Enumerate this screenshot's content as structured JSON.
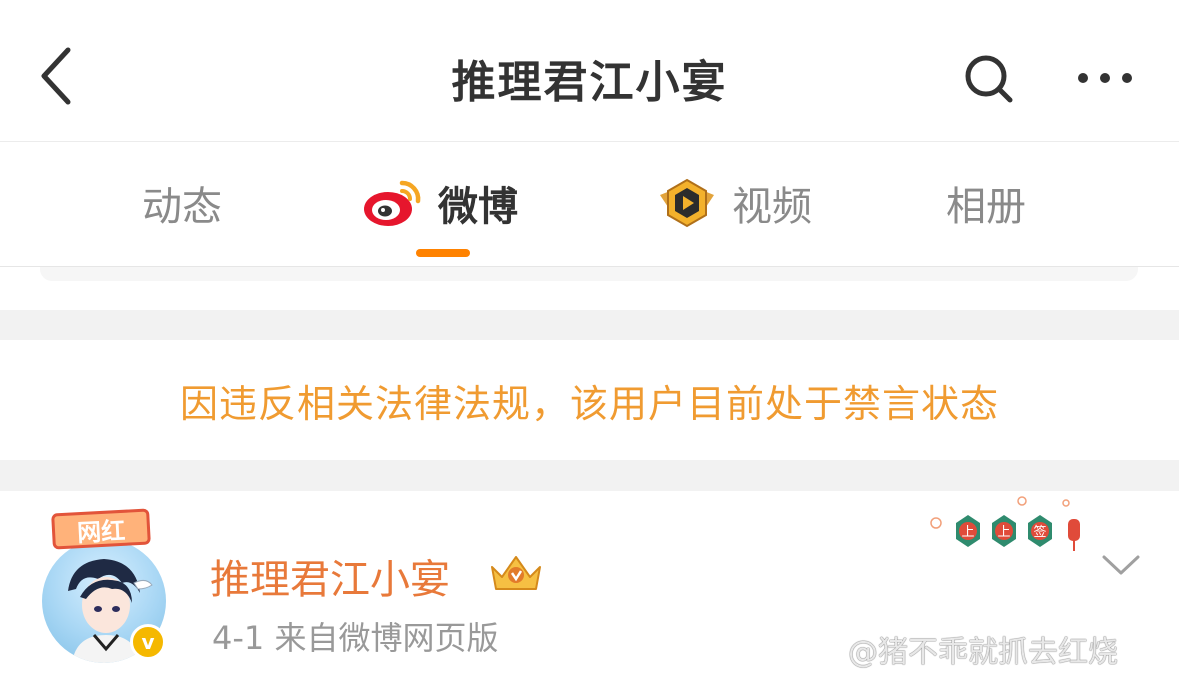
{
  "header": {
    "title": "推理君江小宴",
    "back_icon": "chevron-left-icon",
    "search_icon": "search-icon",
    "more_icon": "more-horizontal-icon"
  },
  "tabs": [
    {
      "label": "动态",
      "icon": "",
      "active": false
    },
    {
      "label": "微博",
      "icon": "weibo-logo-icon",
      "active": true
    },
    {
      "label": "视频",
      "icon": "video-badge-icon",
      "active": false
    },
    {
      "label": "相册",
      "icon": "",
      "active": false
    }
  ],
  "notice": {
    "text": "因违反相关法律法规，该用户目前处于禁言状态"
  },
  "post": {
    "avatar_tag": "网红",
    "author_name": "推理君江小宴",
    "verified_mark": "v",
    "meta": "4-1  来自微博网页版",
    "fortune_labels": [
      "上",
      "上",
      "签"
    ],
    "watermark": "@猪不乖就抓去红烧"
  },
  "colors": {
    "accent_orange": "#ff8200",
    "notice_text": "#f09b31",
    "name_orange": "#e8793a",
    "band_gray": "#f2f2f2",
    "fortune_green": "#2f8b6e",
    "fortune_red": "#e04b3a"
  }
}
